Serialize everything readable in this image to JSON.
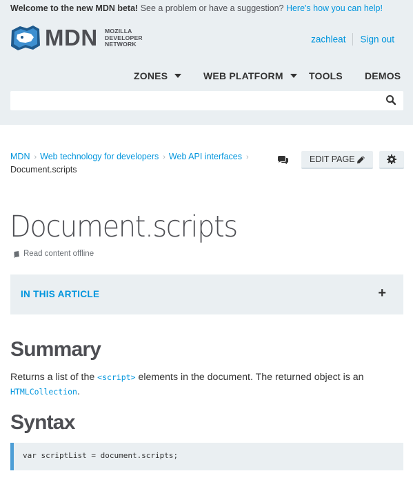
{
  "banner": {
    "bold": "Welcome to the new MDN beta!",
    "text": " See a problem or have a suggestion? ",
    "link": "Here's how you can help!"
  },
  "logo": {
    "word": "MDN",
    "sub1": "MOZILLA",
    "sub2": "DEVELOPER",
    "sub3": "NETWORK"
  },
  "user": {
    "username": "zachleat",
    "signout": "Sign out"
  },
  "nav": {
    "zones": "ZONES",
    "web_platform": "WEB PLATFORM",
    "tools": "TOOLS",
    "demos": "DEMOS"
  },
  "search": {
    "placeholder": ""
  },
  "breadcrumbs": {
    "items": [
      "MDN",
      "Web technology for developers",
      "Web API interfaces"
    ],
    "current": "Document.scripts"
  },
  "toolbar": {
    "edit_label": "EDIT PAGE"
  },
  "page": {
    "title": "Document.scripts",
    "offline": "Read content offline"
  },
  "toc": {
    "label": "IN THIS ARTICLE",
    "toggle": "+"
  },
  "summary": {
    "heading": "Summary",
    "text1": "Returns a list of the ",
    "code1": "<script>",
    "text2": " elements in the document. The returned object is an ",
    "code2": "HTMLCollection",
    "text3": "."
  },
  "syntax": {
    "heading": "Syntax",
    "code": "var scriptList = document.scripts;"
  },
  "colors": {
    "link": "#0095dd",
    "masthead_bg": "#eaeff2",
    "text": "#4d4e53"
  }
}
